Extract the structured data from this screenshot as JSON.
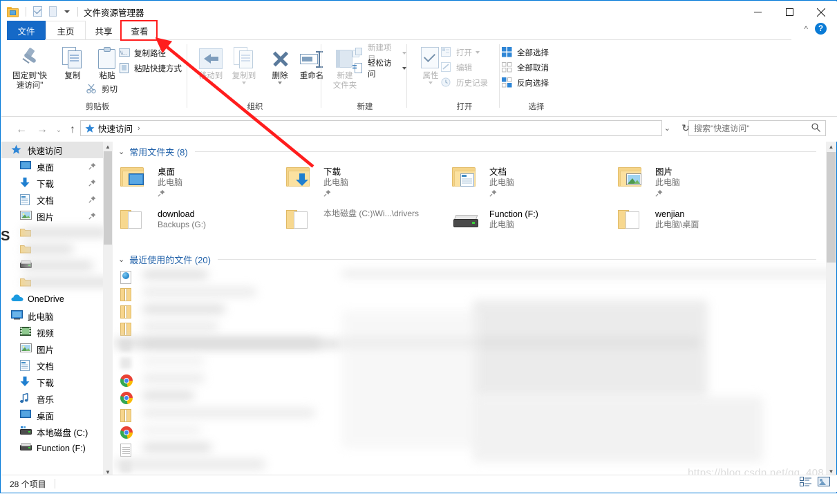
{
  "window": {
    "app_title": "文件资源管理器",
    "minimize": "最小化",
    "maximize": "最大化",
    "close": "关闭",
    "help": "?",
    "collapse_ribbon": "^"
  },
  "tabs": [
    {
      "id": "file",
      "label": "文件"
    },
    {
      "id": "home",
      "label": "主页"
    },
    {
      "id": "share",
      "label": "共享"
    },
    {
      "id": "view",
      "label": "查看",
      "highlighted": true
    }
  ],
  "ribbon": {
    "groups": [
      {
        "name": "剪贴板",
        "big": [
          {
            "label": "固定到\"快\n速访问\"",
            "line1": "固定到\"快",
            "line2": "速访问\"",
            "icon": "pin-icon",
            "disabled": false
          },
          {
            "label": "复制",
            "icon": "copy-icon",
            "disabled": false
          },
          {
            "label": "粘贴",
            "icon": "paste-icon",
            "disabled": false
          }
        ],
        "small": [
          {
            "label": "复制路径",
            "icon": "copy-path-icon",
            "disabled": false
          },
          {
            "label": "粘贴快捷方式",
            "icon": "paste-shortcut-icon",
            "disabled": false
          },
          {
            "label": "剪切",
            "icon": "scissors-icon",
            "disabled": false
          }
        ]
      },
      {
        "name": "组织",
        "big": [
          {
            "label": "移动到",
            "icon": "move-to-icon",
            "disabled": true,
            "has_caret": true
          },
          {
            "label": "复制到",
            "icon": "copy-to-icon",
            "disabled": true,
            "has_caret": true
          },
          {
            "label": "删除",
            "icon": "delete-icon",
            "disabled": false,
            "has_caret": true
          },
          {
            "label": "重命名",
            "icon": "rename-icon",
            "disabled": false
          }
        ]
      },
      {
        "name": "新建",
        "big": [
          {
            "label": "新建\n文件夹",
            "line1": "新建",
            "line2": "文件夹",
            "icon": "new-folder-icon",
            "disabled": true
          }
        ],
        "small": [
          {
            "label": "新建项目",
            "icon": "new-item-icon",
            "disabled": true,
            "has_caret": true
          },
          {
            "label": "轻松访问",
            "icon": "easy-access-icon",
            "disabled": false,
            "has_caret": true
          }
        ]
      },
      {
        "name": "打开",
        "big": [
          {
            "label": "属性",
            "icon": "properties-icon",
            "disabled": true,
            "has_caret": true
          }
        ],
        "small": [
          {
            "label": "打开",
            "icon": "open-icon",
            "disabled": true,
            "has_caret": true
          },
          {
            "label": "编辑",
            "icon": "edit-icon",
            "disabled": true
          },
          {
            "label": "历史记录",
            "icon": "history-icon",
            "disabled": true
          }
        ]
      },
      {
        "name": "选择",
        "small": [
          {
            "label": "全部选择",
            "icon": "select-all-icon",
            "disabled": false
          },
          {
            "label": "全部取消",
            "icon": "select-none-icon",
            "disabled": false
          },
          {
            "label": "反向选择",
            "icon": "invert-selection-icon",
            "disabled": false
          }
        ]
      }
    ]
  },
  "addressbar": {
    "back": "←",
    "forward": "→",
    "history_caret": "⌄",
    "up": "↑",
    "crumb": "快速访问",
    "crumb_sep": "›",
    "dropdown": "⌄",
    "refresh": "↻"
  },
  "search": {
    "placeholder": "搜索\"快速访问\"",
    "value": "",
    "icon": "search-icon"
  },
  "sidebar": {
    "items": [
      {
        "label": "快速访问",
        "icon": "star-icon",
        "selected": true,
        "indent": 0,
        "pinned": false
      },
      {
        "label": "桌面",
        "icon": "desktop-icon",
        "indent": 1,
        "pinned": true
      },
      {
        "label": "下载",
        "icon": "download-icon",
        "indent": 1,
        "pinned": true
      },
      {
        "label": "文档",
        "icon": "documents-icon",
        "indent": 1,
        "pinned": true
      },
      {
        "label": "图片",
        "icon": "pictures-icon",
        "indent": 1,
        "pinned": true
      },
      {
        "label": "",
        "icon": "folder-icon",
        "indent": 1,
        "blurred": true
      },
      {
        "label": "",
        "icon": "folder-icon",
        "indent": 1,
        "blurred": true
      },
      {
        "label": "",
        "icon": "drive-icon",
        "indent": 1,
        "blurred": true
      },
      {
        "label": "",
        "icon": "folder-icon",
        "indent": 1,
        "blurred": true
      },
      {
        "label": "OneDrive",
        "icon": "onedrive-icon",
        "indent": 0,
        "pinned": false
      },
      {
        "label": "此电脑",
        "icon": "this-pc-icon",
        "indent": 0,
        "pinned": false
      },
      {
        "label": "视频",
        "icon": "videos-icon",
        "indent": 1,
        "pinned": false
      },
      {
        "label": "图片",
        "icon": "pictures-icon",
        "indent": 1,
        "pinned": false
      },
      {
        "label": "文档",
        "icon": "documents-icon",
        "indent": 1,
        "pinned": false
      },
      {
        "label": "下载",
        "icon": "download-icon",
        "indent": 1,
        "pinned": false
      },
      {
        "label": "音乐",
        "icon": "music-icon",
        "indent": 1,
        "pinned": false
      },
      {
        "label": "桌面",
        "icon": "desktop-icon",
        "indent": 1,
        "pinned": false
      },
      {
        "label": "本地磁盘 (C:)",
        "icon": "local-disk-icon",
        "indent": 1,
        "pinned": false
      },
      {
        "label": "Function (F:)",
        "icon": "drive-icon",
        "indent": 1,
        "pinned": false
      }
    ]
  },
  "content": {
    "frequent_section": {
      "title": "常用文件夹 (8)",
      "chevron": "⌄",
      "tiles": [
        {
          "name": "桌面",
          "sub": "此电脑",
          "icon": "folder-desktop-icon",
          "pinned": true
        },
        {
          "name": "下载",
          "sub": "此电脑",
          "icon": "folder-download-icon",
          "pinned": true
        },
        {
          "name": "文档",
          "sub": "此电脑",
          "icon": "folder-documents-icon",
          "pinned": true
        },
        {
          "name": "图片",
          "sub": "此电脑",
          "icon": "folder-pictures-icon",
          "pinned": true
        },
        {
          "name": "download",
          "sub": "Backups (G:)",
          "icon": "folder-open-icon",
          "pinned": false
        },
        {
          "name": "",
          "sub": "本地磁盘 (C:)\\Wi...\\drivers",
          "icon": "folder-open-icon",
          "pinned": false
        },
        {
          "name": "Function (F:)",
          "sub": "此电脑",
          "icon": "drive-icon",
          "pinned": false
        },
        {
          "name": "wenjian",
          "sub": "此电脑\\桌面",
          "icon": "folder-open-icon",
          "pinned": false
        }
      ]
    },
    "recent_section": {
      "title": "最近使用的文件 (20)",
      "chevron": "⌄",
      "files": [
        {
          "icon": "html-file-icon",
          "blurred": true
        },
        {
          "icon": "zip-file-icon",
          "blurred": true
        },
        {
          "icon": "zip-file-icon",
          "blurred": true
        },
        {
          "icon": "zip-file-icon",
          "blurred": true
        },
        {
          "icon": "blurred-file-icon",
          "blurred": true
        },
        {
          "icon": "blurred-file-icon",
          "blurred": true
        },
        {
          "icon": "chrome-file-icon",
          "blurred": true
        },
        {
          "icon": "chrome-file-icon",
          "blurred": true
        },
        {
          "icon": "zip-file-icon",
          "blurred": true
        },
        {
          "icon": "chrome-file-icon",
          "blurred": true
        },
        {
          "icon": "text-file-icon",
          "blurred": true
        },
        {
          "icon": "blurred-file-icon",
          "blurred": true
        }
      ]
    }
  },
  "statusbar": {
    "item_count": "28 个项目",
    "view_details": "详细信息视图",
    "view_large": "大图标视图"
  },
  "watermark": "https://blog.csdn.net/qq_408",
  "annotation": {
    "type": "arrow",
    "color": "#ff1d1d",
    "points_to": "查看"
  }
}
